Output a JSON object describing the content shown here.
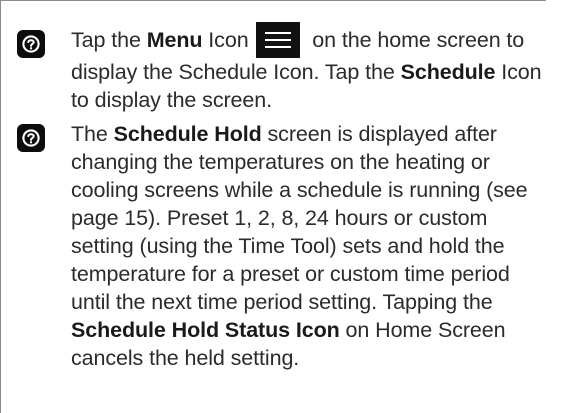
{
  "item_1": {
    "badge_icon": "question-circle-icon",
    "part_1": "Tap the ",
    "bold_1": "Menu",
    "part_2": " Icon ",
    "inline_icon": "hamburger-menu-icon",
    "part_3": " on the home screen to display the Schedule Icon. Tap the ",
    "bold_2": "Schedule",
    "part_4": " Icon to display the screen."
  },
  "item_2": {
    "badge_icon": "question-circle-icon",
    "part_1": "The ",
    "bold_1": "Schedule Hold",
    "part_2": " screen is displayed after changing the temperatures on the heating or cooling screens while a schedule is running (see page 15). Preset 1, 2, 8, 24 hours or custom setting (using the Time Tool) sets and hold the temperature for a preset or custom time period until the next time period setting. Tapping the ",
    "bold_2": "Schedule Hold Status Icon",
    "part_3": " on Home Screen cancels the held setting."
  },
  "colors": {
    "text": "#2b2b2b",
    "badge": "#0d0d0d",
    "menu_icon_bg": "#111111",
    "rule": "#8c8c8c"
  }
}
